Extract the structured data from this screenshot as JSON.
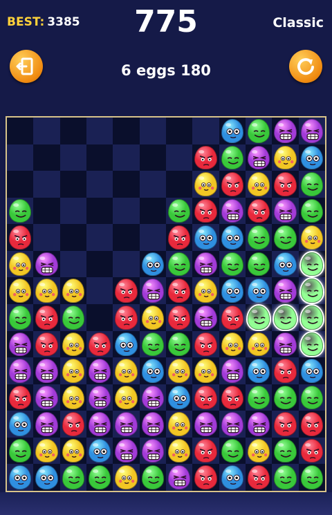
{
  "header": {
    "best_label": "BEST:",
    "best_value": "3385",
    "score": "775",
    "mode": "Classic",
    "combo": "6 eggs 180",
    "exit_icon": "exit-door-icon",
    "restart_icon": "restart-icon"
  },
  "colors": {
    "yellow": "#f2c624",
    "red": "#e8293c",
    "green": "#39c83a",
    "blue": "#2f8fe0",
    "purple": "#a23bd8",
    "accent_orange": "#f39a1d",
    "board_border": "#d9c48a"
  },
  "board": {
    "columns": 12,
    "rows": 14,
    "cells": [
      [
        0,
        0,
        0,
        0,
        0,
        0,
        0,
        0,
        "B",
        "G",
        "P",
        "P"
      ],
      [
        0,
        0,
        0,
        0,
        0,
        0,
        0,
        "R",
        "G",
        "P",
        "Y",
        "B"
      ],
      [
        0,
        0,
        0,
        0,
        0,
        0,
        0,
        "Y",
        "R",
        "Y",
        "R",
        "G"
      ],
      [
        "G",
        0,
        0,
        0,
        0,
        0,
        "G",
        "R",
        "P",
        "R",
        "P",
        "G"
      ],
      [
        "R",
        0,
        0,
        0,
        0,
        0,
        "R",
        "B",
        "B",
        "G",
        "G",
        "Y"
      ],
      [
        "Y",
        "P",
        0,
        0,
        0,
        "B",
        "G",
        "P",
        "G",
        "G",
        "B",
        "G*"
      ],
      [
        "Y",
        "Y",
        "Y",
        0,
        "R",
        "P",
        "R",
        "Y",
        "B",
        "B",
        "P",
        "G*"
      ],
      [
        "G",
        "R",
        "G",
        0,
        "R",
        "Y",
        "R",
        "P",
        "R",
        "G*",
        "G*",
        "G*"
      ],
      [
        "P",
        "R",
        "Y",
        "R",
        "B",
        "G",
        "G",
        "R",
        "Y",
        "Y",
        "P",
        "G*"
      ],
      [
        "P",
        "P",
        "Y",
        "P",
        "Y",
        "B",
        "Y",
        "Y",
        "P",
        "B",
        "R",
        "B"
      ],
      [
        "R",
        "P",
        "Y",
        "P",
        "Y",
        "P",
        "B",
        "R",
        "R",
        "G",
        "G",
        "G"
      ],
      [
        "B",
        "P",
        "R",
        "P",
        "P",
        "P",
        "Y",
        "P",
        "P",
        "P",
        "R",
        "R"
      ],
      [
        "G",
        "Y",
        "Y",
        "B",
        "P",
        "P",
        "Y",
        "R",
        "G",
        "Y",
        "G",
        "R"
      ],
      [
        "B",
        "B",
        "G",
        "G",
        "Y",
        "G",
        "P",
        "R",
        "B",
        "R",
        "G",
        "G"
      ]
    ]
  }
}
